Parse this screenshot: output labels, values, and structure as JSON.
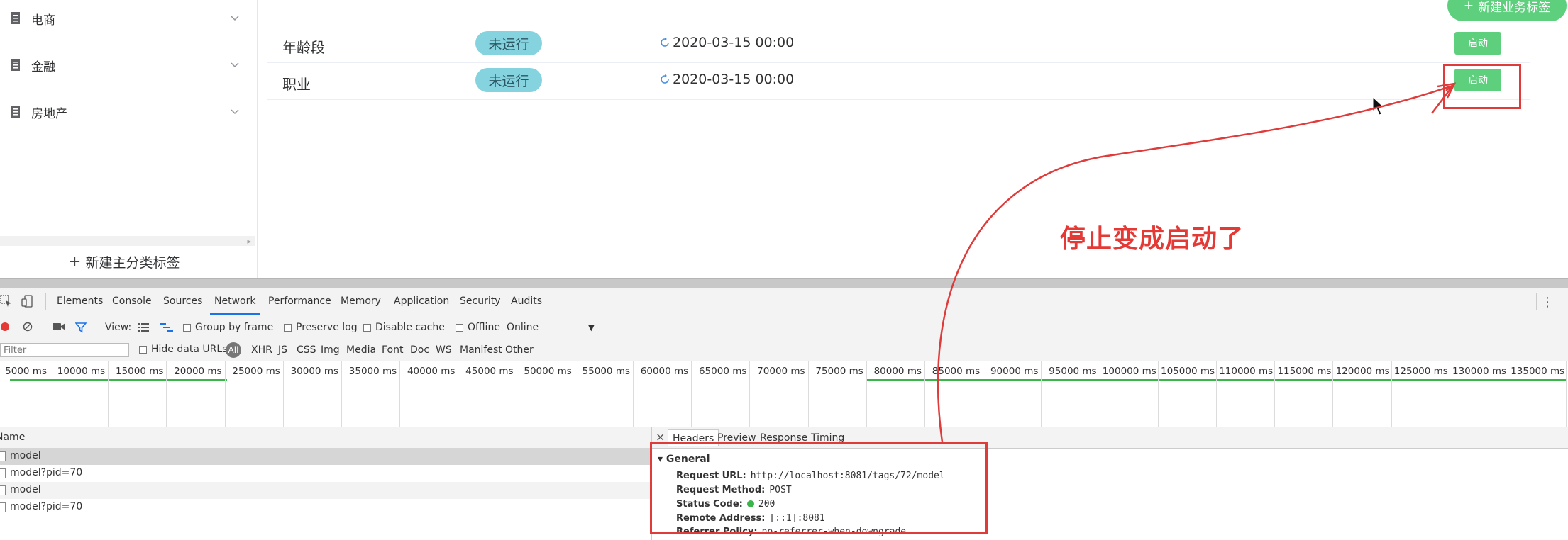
{
  "sidebar": {
    "items": [
      {
        "label": "电商"
      },
      {
        "label": "金融"
      },
      {
        "label": "房地产"
      }
    ],
    "new_main_label": "新建主分类标签"
  },
  "main": {
    "new_biz_label": "新建业务标签",
    "rows": [
      {
        "name": "年龄段",
        "status": "未运行",
        "time": "2020-03-15 00:00",
        "action": "启动"
      },
      {
        "name": "职业",
        "status": "未运行",
        "time": "2020-03-15 00:00",
        "action": "启动"
      }
    ]
  },
  "annotation": {
    "text": "停止变成启动了",
    "color": "#e53935"
  },
  "devtools": {
    "tabs": [
      "Elements",
      "Console",
      "Sources",
      "Network",
      "Performance",
      "Memory",
      "Application",
      "Security",
      "Audits"
    ],
    "active_tab": "Network",
    "toolbar": {
      "view_label": "View:",
      "group_by_frame": "Group by frame",
      "preserve_log": "Preserve log",
      "disable_cache": "Disable cache",
      "offline": "Offline",
      "throttle": "Online"
    },
    "filter": {
      "placeholder": "Filter",
      "hide_data_urls": "Hide data URLs",
      "all": "All",
      "types": [
        "XHR",
        "JS",
        "CSS",
        "Img",
        "Media",
        "Font",
        "Doc",
        "WS",
        "Manifest",
        "Other"
      ]
    },
    "timeline": {
      "ticks": [
        "5000 ms",
        "10000 ms",
        "15000 ms",
        "20000 ms",
        "25000 ms",
        "30000 ms",
        "35000 ms",
        "40000 ms",
        "45000 ms",
        "50000 ms",
        "55000 ms",
        "60000 ms",
        "65000 ms",
        "70000 ms",
        "75000 ms",
        "80000 ms",
        "85000 ms",
        "90000 ms",
        "95000 ms",
        "100000 ms",
        "105000 ms",
        "110000 ms",
        "115000 ms",
        "120000 ms",
        "125000 ms",
        "130000 ms",
        "135000 ms"
      ]
    },
    "list": {
      "header": "Name",
      "rows": [
        "model",
        "model?pid=70",
        "model",
        "model?pid=70"
      ]
    },
    "detail": {
      "tabs": [
        "Headers",
        "Preview",
        "Response",
        "Timing"
      ],
      "general_title": "General",
      "fields": [
        {
          "key": "Request URL:",
          "value": "http://localhost:8081/tags/72/model"
        },
        {
          "key": "Request Method:",
          "value": "POST"
        },
        {
          "key": "Status Code:",
          "value": "200"
        },
        {
          "key": "Remote Address:",
          "value": "[::1]:8081"
        },
        {
          "key": "Referrer Policy:",
          "value": "no-referrer-when-downgrade"
        }
      ]
    }
  }
}
